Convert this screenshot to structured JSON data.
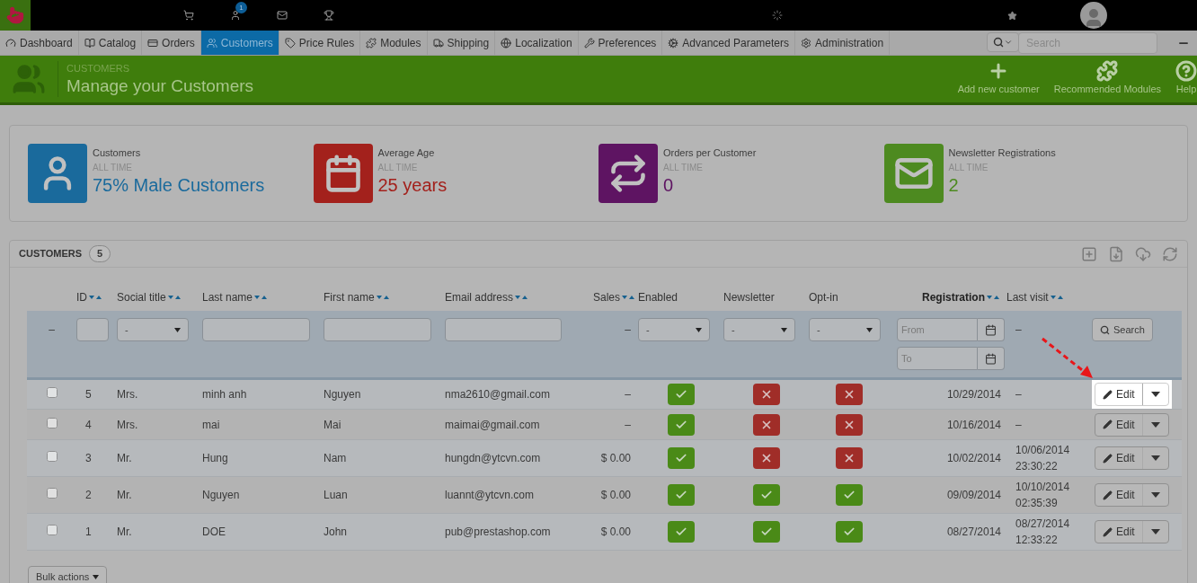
{
  "top_bar": {
    "notification_badge": "1"
  },
  "nav": {
    "tabs": [
      {
        "label": "Dashboard",
        "selected": false
      },
      {
        "label": "Catalog",
        "selected": false
      },
      {
        "label": "Orders",
        "selected": false
      },
      {
        "label": "Customers",
        "selected": true
      },
      {
        "label": "Price Rules",
        "selected": false
      },
      {
        "label": "Modules",
        "selected": false
      },
      {
        "label": "Shipping",
        "selected": false
      },
      {
        "label": "Localization",
        "selected": false
      },
      {
        "label": "Preferences",
        "selected": false
      },
      {
        "label": "Advanced Parameters",
        "selected": false
      },
      {
        "label": "Administration",
        "selected": false
      }
    ],
    "search": {
      "placeholder": "Search"
    }
  },
  "header": {
    "breadcrumb": "CUSTOMERS",
    "title": "Manage your Customers",
    "actions": [
      "Add new customer",
      "Recommended Modules",
      "Help"
    ]
  },
  "kpis": [
    {
      "label": "Customers",
      "period": "ALL TIME",
      "value": "75% Male Customers",
      "color": "#1a6a9c"
    },
    {
      "label": "Average Age",
      "period": "ALL TIME",
      "value": "25 years",
      "color": "#a3211c"
    },
    {
      "label": "Orders per Customer",
      "period": "ALL TIME",
      "value": "0",
      "color": "#5e1462"
    },
    {
      "label": "Newsletter Registrations",
      "period": "ALL TIME",
      "value": "2",
      "color": "#4d8a20"
    }
  ],
  "panel": {
    "title": "CUSTOMERS",
    "count": "5"
  },
  "columns": [
    {
      "label": "ID",
      "sortable": true,
      "bold": false
    },
    {
      "label": "Social title",
      "sortable": true,
      "bold": false
    },
    {
      "label": "Last name",
      "sortable": true,
      "bold": false
    },
    {
      "label": "First name",
      "sortable": true,
      "bold": false
    },
    {
      "label": "Email address",
      "sortable": true,
      "bold": false
    },
    {
      "label": "Sales",
      "sortable": true,
      "bold": false
    },
    {
      "label": "Enabled",
      "sortable": false,
      "bold": false
    },
    {
      "label": "Newsletter",
      "sortable": false,
      "bold": false
    },
    {
      "label": "Opt-in",
      "sortable": false,
      "bold": false
    },
    {
      "label": "Registration",
      "sortable": true,
      "bold": true
    },
    {
      "label": "Last visit",
      "sortable": true,
      "bold": false
    }
  ],
  "filter": {
    "check_dash": "–",
    "social_title": "-",
    "sales_dash": "–",
    "enabled": "-",
    "newsletter": "-",
    "optin": "-",
    "from_placeholder": "From",
    "to_placeholder": "To",
    "last_visit_dash": "–",
    "search_button": "Search"
  },
  "rows": [
    {
      "id": "5",
      "title": "Mrs.",
      "last_name": "minh anh",
      "first_name": "Nguyen",
      "email": "nma2610@gmail.com",
      "sales": "–",
      "enabled": true,
      "newsletter": false,
      "optin": false,
      "registration": "10/29/2014",
      "last_visit": [
        "–"
      ],
      "action": "Edit",
      "highlighted": true,
      "checked": false
    },
    {
      "id": "4",
      "title": "Mrs.",
      "last_name": "mai",
      "first_name": "Mai",
      "email": "maimai@gmail.com",
      "sales": "–",
      "enabled": true,
      "newsletter": false,
      "optin": false,
      "registration": "10/16/2014",
      "last_visit": [
        "–"
      ],
      "action": "Edit",
      "highlighted": false,
      "checked": false
    },
    {
      "id": "3",
      "title": "Mr.",
      "last_name": "Hung",
      "first_name": "Nam",
      "email": "hungdn@ytcvn.com",
      "sales": "$ 0.00",
      "enabled": true,
      "newsletter": false,
      "optin": false,
      "registration": "10/02/2014",
      "last_visit": [
        "10/06/2014",
        "23:30:22"
      ],
      "action": "Edit",
      "highlighted": false,
      "checked": false
    },
    {
      "id": "2",
      "title": "Mr.",
      "last_name": "Nguyen",
      "first_name": "Luan",
      "email": "luannt@ytcvn.com",
      "sales": "$ 0.00",
      "enabled": true,
      "newsletter": true,
      "optin": true,
      "registration": "09/09/2014",
      "last_visit": [
        "10/10/2014",
        "02:35:39"
      ],
      "action": "Edit",
      "highlighted": false,
      "checked": false
    },
    {
      "id": "1",
      "title": "Mr.",
      "last_name": "DOE",
      "first_name": "John",
      "email": "pub@prestashop.com",
      "sales": "$ 0.00",
      "enabled": true,
      "newsletter": true,
      "optin": true,
      "registration": "08/27/2014",
      "last_visit": [
        "08/27/2014",
        "12:33:22"
      ],
      "action": "Edit",
      "highlighted": false,
      "checked": false
    }
  ],
  "bulk_actions": "Bulk actions"
}
